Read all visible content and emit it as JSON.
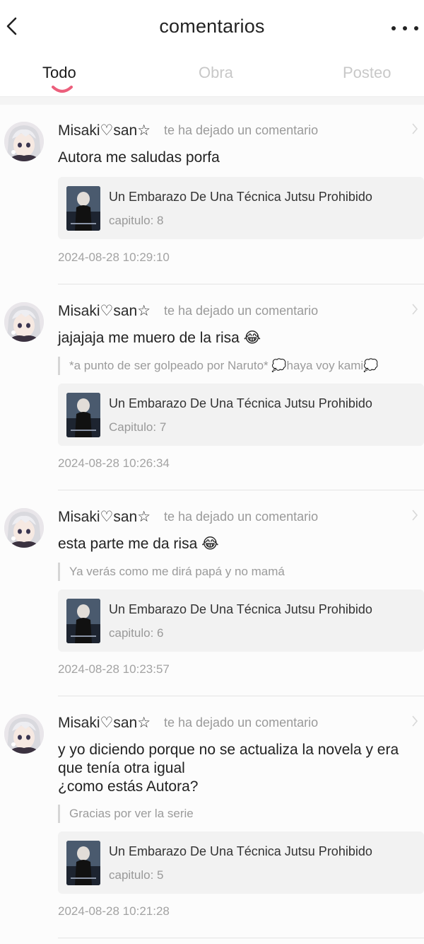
{
  "header": {
    "title": "comentarios",
    "back_icon": "chevron-left-icon",
    "more_icon": "more-dots-icon"
  },
  "tabs": [
    {
      "label": "Todo",
      "active": true
    },
    {
      "label": "Obra",
      "active": false
    },
    {
      "label": "Posteo",
      "active": false
    }
  ],
  "colors": {
    "accent": "#ec5f7c",
    "card_bg": "#f2f2f2",
    "muted_text": "#9a9a9a"
  },
  "notifications": [
    {
      "username": "Misaki♡san☆",
      "action": "te ha dejado un comentario",
      "comment": "Autora me saludas porfa",
      "quote": "",
      "work_title": "Un Embarazo De Una Técnica Jutsu Prohibido",
      "chapter": "capitulo: 8",
      "timestamp": "2024-08-28 10:29:10"
    },
    {
      "username": "Misaki♡san☆",
      "action": "te ha dejado un comentario",
      "comment": "jajajaja me muero de la risa 😂",
      "quote": "*a punto de ser golpeado por Naruto* 💭haya voy kami💭",
      "work_title": "Un Embarazo De Una Técnica Jutsu Prohibido",
      "chapter": "Capitulo: 7",
      "timestamp": "2024-08-28 10:26:34"
    },
    {
      "username": "Misaki♡san☆",
      "action": "te ha dejado un comentario",
      "comment": "esta parte me da risa 😂",
      "quote": "Ya verás como me dirá papá y no mamá",
      "work_title": "Un Embarazo De Una Técnica Jutsu Prohibido",
      "chapter": "capitulo: 6",
      "timestamp": "2024-08-28 10:23:57"
    },
    {
      "username": "Misaki♡san☆",
      "action": "te ha dejado un comentario",
      "comment": "y yo diciendo porque no se actualiza la novela y era que tenía otra igual\n¿como estás Autora?",
      "quote": "Gracias por ver la serie",
      "work_title": "Un Embarazo De Una Técnica Jutsu Prohibido",
      "chapter": "capitulo: 5",
      "timestamp": "2024-08-28 10:21:28"
    }
  ]
}
